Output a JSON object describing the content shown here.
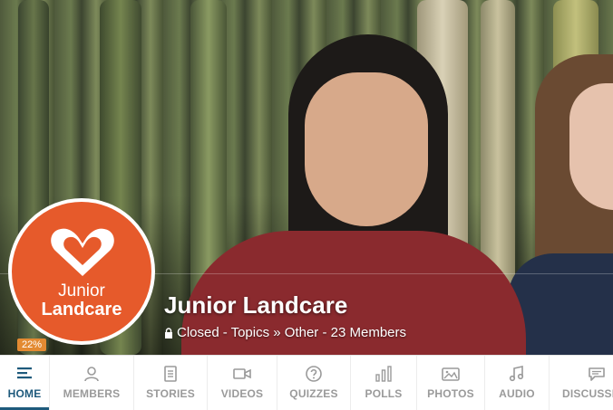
{
  "group": {
    "logo_line1": "Junior",
    "logo_line2": "Landcare",
    "title": "Junior Landcare",
    "privacy": "Closed",
    "meta_rest": "- Topics » Other - 23 Members",
    "progress_label": "22%",
    "progress_value": 22
  },
  "tabs": [
    {
      "label": "HOME",
      "icon": "home-icon",
      "active": true
    },
    {
      "label": "MEMBERS",
      "icon": "members-icon",
      "active": false
    },
    {
      "label": "STORIES",
      "icon": "stories-icon",
      "active": false
    },
    {
      "label": "VIDEOS",
      "icon": "videos-icon",
      "active": false
    },
    {
      "label": "QUIZZES",
      "icon": "quizzes-icon",
      "active": false
    },
    {
      "label": "POLLS",
      "icon": "polls-icon",
      "active": false
    },
    {
      "label": "PHOTOS",
      "icon": "photos-icon",
      "active": false
    },
    {
      "label": "AUDIO",
      "icon": "audio-icon",
      "active": false
    },
    {
      "label": "DISCUSSIONS",
      "icon": "discussions-icon",
      "active": false
    }
  ],
  "colors": {
    "accent": "#1e5a7c",
    "logo_bg": "#e65a2b",
    "badge_bg": "#e38a32",
    "tab_text": "#9a9a9a"
  }
}
